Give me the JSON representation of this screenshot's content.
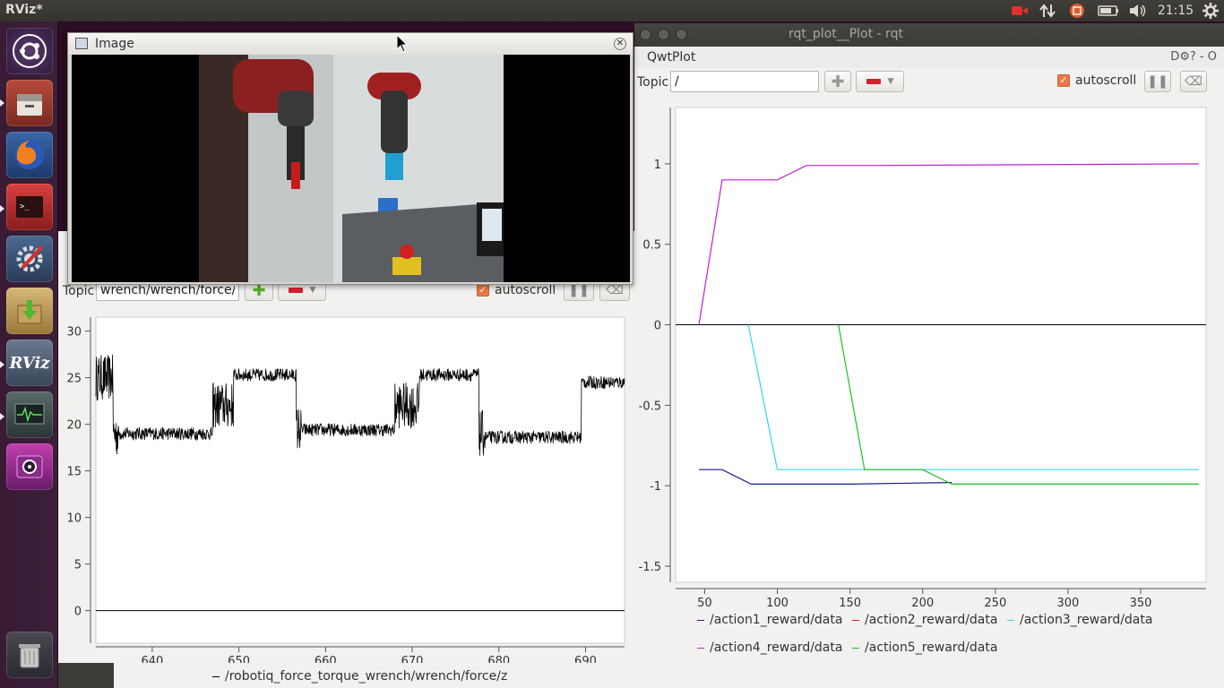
{
  "top_panel": {
    "app_title": "RViz*",
    "clock": "21:15",
    "indicators": [
      "record-icon",
      "network-icon",
      "input-method-icon",
      "battery-icon",
      "volume-icon",
      "settings-gear-icon"
    ]
  },
  "launcher": {
    "items": [
      "ubuntu-dash",
      "files",
      "firefox",
      "terminal-app",
      "system-settings",
      "software-updater",
      "rviz",
      "system-monitor",
      "webcam-app",
      "trash"
    ],
    "rviz_label": "RViz"
  },
  "rqt_window": {
    "title": "rqt_plot__Plot - rqt",
    "dock_title": "QwtPlot",
    "dock_controls": "D⚙? - O",
    "topic_label": "Topic",
    "topic_value": "/",
    "autoscroll_label": "autoscroll",
    "legend": [
      {
        "label": "/action1_reward/data",
        "color": "#1a1a8c"
      },
      {
        "label": "/action2_reward/data",
        "color": "#d02020"
      },
      {
        "label": "/action3_reward/data",
        "color": "#30d8e0"
      },
      {
        "label": "/action4_reward/data",
        "color": "#c020d0"
      },
      {
        "label": "/action5_reward/data",
        "color": "#20c020"
      }
    ]
  },
  "left_plot_window": {
    "topic_label": "Topic",
    "topic_value": "wrench/wrench/force/z",
    "autoscroll_label": "autoscroll",
    "legend": [
      {
        "label": "/robotiq_force_torque_wrench/wrench/force/z",
        "color": "#000000"
      }
    ]
  },
  "image_window": {
    "title": "Image"
  },
  "chart_data": [
    {
      "type": "line",
      "xlim": [
        30,
        395
      ],
      "ylim": [
        -1.6,
        1.35
      ],
      "xticks": [
        50,
        100,
        150,
        200,
        250,
        300,
        350
      ],
      "yticks": [
        1,
        0.5,
        0,
        -0.5,
        -1,
        -1.5
      ],
      "ytick_labels": [
        "1",
        "0.5",
        "0",
        "-0.5",
        "-1",
        "-1.5"
      ],
      "grid": false,
      "legend_position": "bottom",
      "series": [
        {
          "name": "/action1_reward/data",
          "color": "#1a1a8c",
          "points": [
            [
              46,
              -0.9
            ],
            [
              62,
              -0.9
            ],
            [
              82,
              -0.99
            ],
            [
              150,
              -0.99
            ],
            [
              220,
              -0.98
            ]
          ]
        },
        {
          "name": "/action2_reward/data",
          "color": "#d02020",
          "points": []
        },
        {
          "name": "/action3_reward/data",
          "color": "#30d8e0",
          "points": [
            [
              80,
              0
            ],
            [
              100,
              -0.9
            ],
            [
              390,
              -0.9
            ]
          ]
        },
        {
          "name": "/action4_reward/data",
          "color": "#c020d0",
          "points": [
            [
              46,
              0
            ],
            [
              62,
              0.9
            ],
            [
              100,
              0.9
            ],
            [
              120,
              0.99
            ],
            [
              170,
              0.99
            ],
            [
              390,
              1.0
            ]
          ]
        },
        {
          "name": "/action5_reward/data",
          "color": "#20c020",
          "points": [
            [
              142,
              0
            ],
            [
              160,
              -0.9
            ],
            [
              200,
              -0.9
            ],
            [
              220,
              -0.99
            ],
            [
              390,
              -0.99
            ]
          ]
        }
      ],
      "zero_line": true
    },
    {
      "type": "line",
      "xlim": [
        633.5,
        694.5
      ],
      "ylim": [
        -3.5,
        31.5
      ],
      "xticks": [
        640,
        650,
        660,
        670,
        680,
        690
      ],
      "yticks": [
        30,
        25,
        20,
        15,
        10,
        5,
        0
      ],
      "grid": false,
      "legend_position": "bottom",
      "series": [
        {
          "name": "/robotiq_force_torque_wrench/wrench/force/z",
          "color": "#000000",
          "segments": [
            [
              633.5,
              635.5,
              25.0
            ],
            [
              635.5,
              636.1,
              19.0
            ],
            [
              636.1,
              647,
              19.0
            ],
            [
              647,
              649.4,
              22.0
            ],
            [
              649.4,
              656.6,
              25.3
            ],
            [
              656.6,
              657.2,
              19.5
            ],
            [
              657.2,
              668.0,
              19.4
            ],
            [
              668.0,
              670.8,
              22.0
            ],
            [
              670.8,
              677.7,
              25.3
            ],
            [
              677.7,
              678.4,
              19.0
            ],
            [
              678.4,
              689.5,
              18.6
            ],
            [
              689.5,
              694.5,
              24.5
            ]
          ]
        }
      ],
      "zero_line": true
    }
  ]
}
